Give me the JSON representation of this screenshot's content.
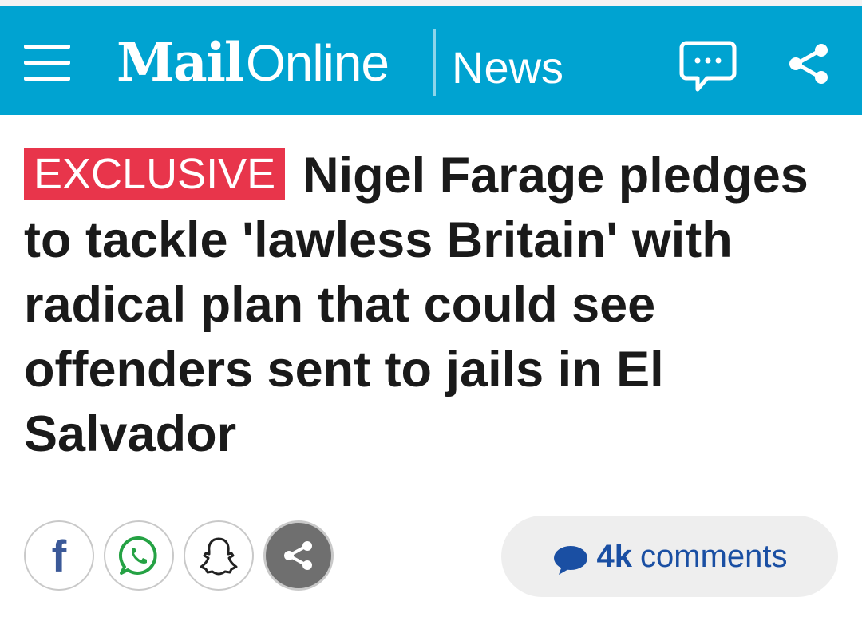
{
  "header": {
    "brand_part1": "Mail",
    "brand_part2": "Online",
    "section": "News"
  },
  "article": {
    "badge": "EXCLUSIVE",
    "headline": "Nigel Farage pledges to tackle 'lawless Britain' with radical plan that could see offenders sent to jails in El Salvador"
  },
  "share": {
    "buttons": [
      "facebook-icon",
      "whatsapp-icon",
      "snapchat-icon",
      "share-icon"
    ]
  },
  "comments": {
    "count": "4k",
    "label": "comments"
  },
  "colors": {
    "header_bg": "#00a3d1",
    "badge_bg": "#e8354b",
    "comments_text": "#1a4fa3",
    "facebook": "#3b5998",
    "whatsapp": "#25a244"
  }
}
